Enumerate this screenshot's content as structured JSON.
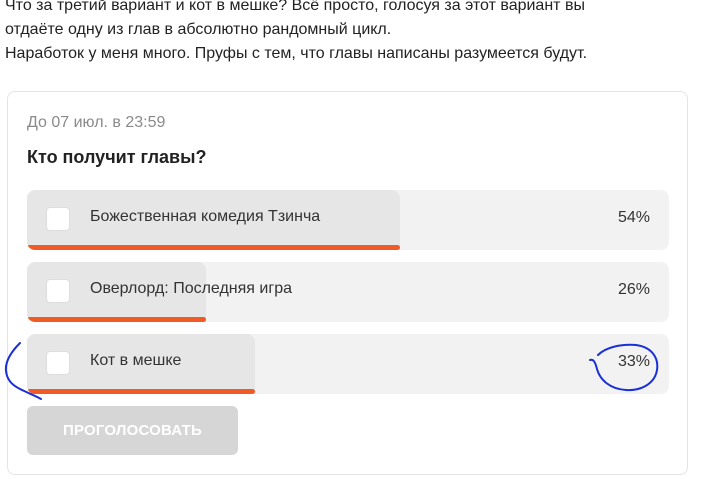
{
  "intro": {
    "line1": "Что за третий вариант и кот в мешке? Всё просто, голосуя за этот вариант вы",
    "line2": "отдаёте одну из глав в абсолютно рандомный цикл.",
    "line3": "Наработок у меня много. Пруфы с тем, что главы написаны разумеется будут."
  },
  "poll": {
    "deadline": "До 07 июл. в 23:59",
    "question": "Кто получит главы?",
    "options": [
      {
        "label": "Божественная комедия Тзинча",
        "percent_text": "54%",
        "bar_fraction": 0.54
      },
      {
        "label": "Оверлорд: Последняя игра",
        "percent_text": "26%",
        "bar_fraction": 0.26
      },
      {
        "label": "Кот в мешке",
        "percent_text": "33%",
        "bar_fraction": 0.33
      }
    ],
    "vote_button": "ПРОГОЛОСОВАТЬ"
  },
  "colors": {
    "accent_bar": "#ef5a26",
    "annotation_ink": "#1a2fd6",
    "disabled_button": "#d6d6d6"
  }
}
